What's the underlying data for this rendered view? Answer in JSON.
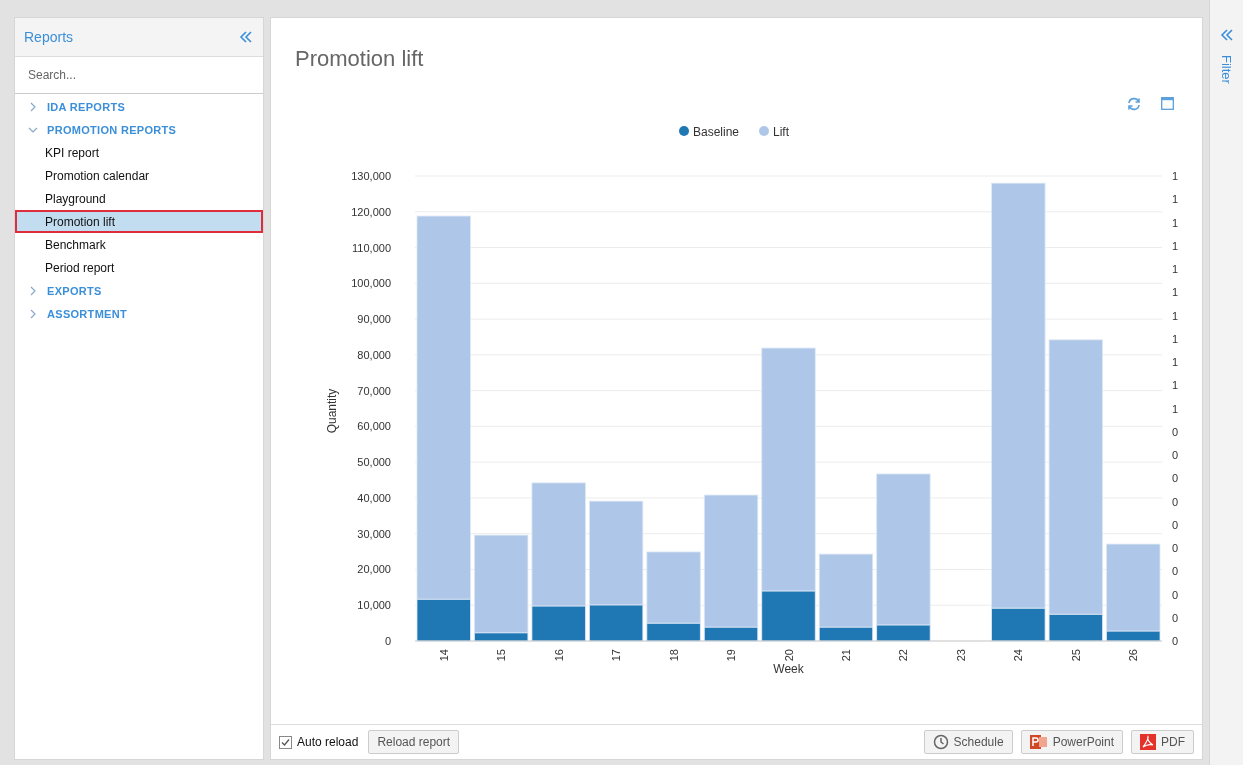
{
  "sidebar": {
    "title": "Reports",
    "search": {
      "placeholder": "Search..."
    },
    "items": [
      {
        "label": "IDA REPORTS",
        "expanded": false,
        "selected": false
      },
      {
        "label": "PROMOTION REPORTS",
        "expanded": true,
        "selected": false,
        "children": [
          {
            "label": "KPI report",
            "selected": false
          },
          {
            "label": "Promotion calendar",
            "selected": false
          },
          {
            "label": "Playground",
            "selected": false
          },
          {
            "label": "Promotion lift",
            "selected": true
          },
          {
            "label": "Benchmark",
            "selected": false
          },
          {
            "label": "Period report",
            "selected": false
          }
        ]
      },
      {
        "label": "EXPORTS",
        "expanded": false,
        "selected": false
      },
      {
        "label": "ASSORTMENT",
        "expanded": false,
        "selected": false
      }
    ]
  },
  "report": {
    "title": "Promotion lift",
    "right_axis_labels": [
      "1",
      "1",
      "1",
      "1",
      "1",
      "1",
      "1",
      "1",
      "1",
      "1",
      "1",
      "0",
      "0",
      "0",
      "0",
      "0",
      "0",
      "0",
      "0",
      "0",
      "0"
    ],
    "chart_data": {
      "type": "bar",
      "stacked": true,
      "grid": true,
      "legend": true,
      "xlabel": "Week",
      "ylabel": "Quantity",
      "categories": [
        "14",
        "15",
        "16",
        "17",
        "18",
        "19",
        "20",
        "21",
        "22",
        "23",
        "24",
        "25",
        "26"
      ],
      "series": [
        {
          "name": "Baseline",
          "color": "#1f77b4",
          "values": [
            11700,
            2300,
            9800,
            10100,
            5000,
            3900,
            14000,
            3900,
            4500,
            0,
            9200,
            7500,
            2800
          ]
        },
        {
          "name": "Lift",
          "color": "#aec7e8",
          "values": [
            107100,
            27300,
            34400,
            29000,
            19900,
            36900,
            67900,
            20400,
            42200,
            0,
            118800,
            76700,
            24300
          ]
        }
      ],
      "ylim": [
        0,
        130000
      ],
      "yticks": [
        {
          "value": 0,
          "label": "0"
        },
        {
          "value": 10000,
          "label": "10,000"
        },
        {
          "value": 20000,
          "label": "20,000"
        },
        {
          "value": 30000,
          "label": "30,000"
        },
        {
          "value": 40000,
          "label": "40,000"
        },
        {
          "value": 50000,
          "label": "50,000"
        },
        {
          "value": 60000,
          "label": "60,000"
        },
        {
          "value": 70000,
          "label": "70,000"
        },
        {
          "value": 80000,
          "label": "80,000"
        },
        {
          "value": 90000,
          "label": "90,000"
        },
        {
          "value": 100000,
          "label": "100,000"
        },
        {
          "value": 110000,
          "label": "110,000"
        },
        {
          "value": 120000,
          "label": "120,000"
        },
        {
          "value": 130000,
          "label": "130,000"
        }
      ]
    }
  },
  "footer": {
    "auto_reload": {
      "label": "Auto reload",
      "checked": true
    },
    "reload_button": "Reload report",
    "actions": [
      {
        "label": "Schedule",
        "kind": "schedule"
      },
      {
        "label": "PowerPoint",
        "kind": "powerpoint"
      },
      {
        "label": "PDF",
        "kind": "pdf"
      }
    ]
  },
  "filter_panel": {
    "label": "Filter"
  }
}
